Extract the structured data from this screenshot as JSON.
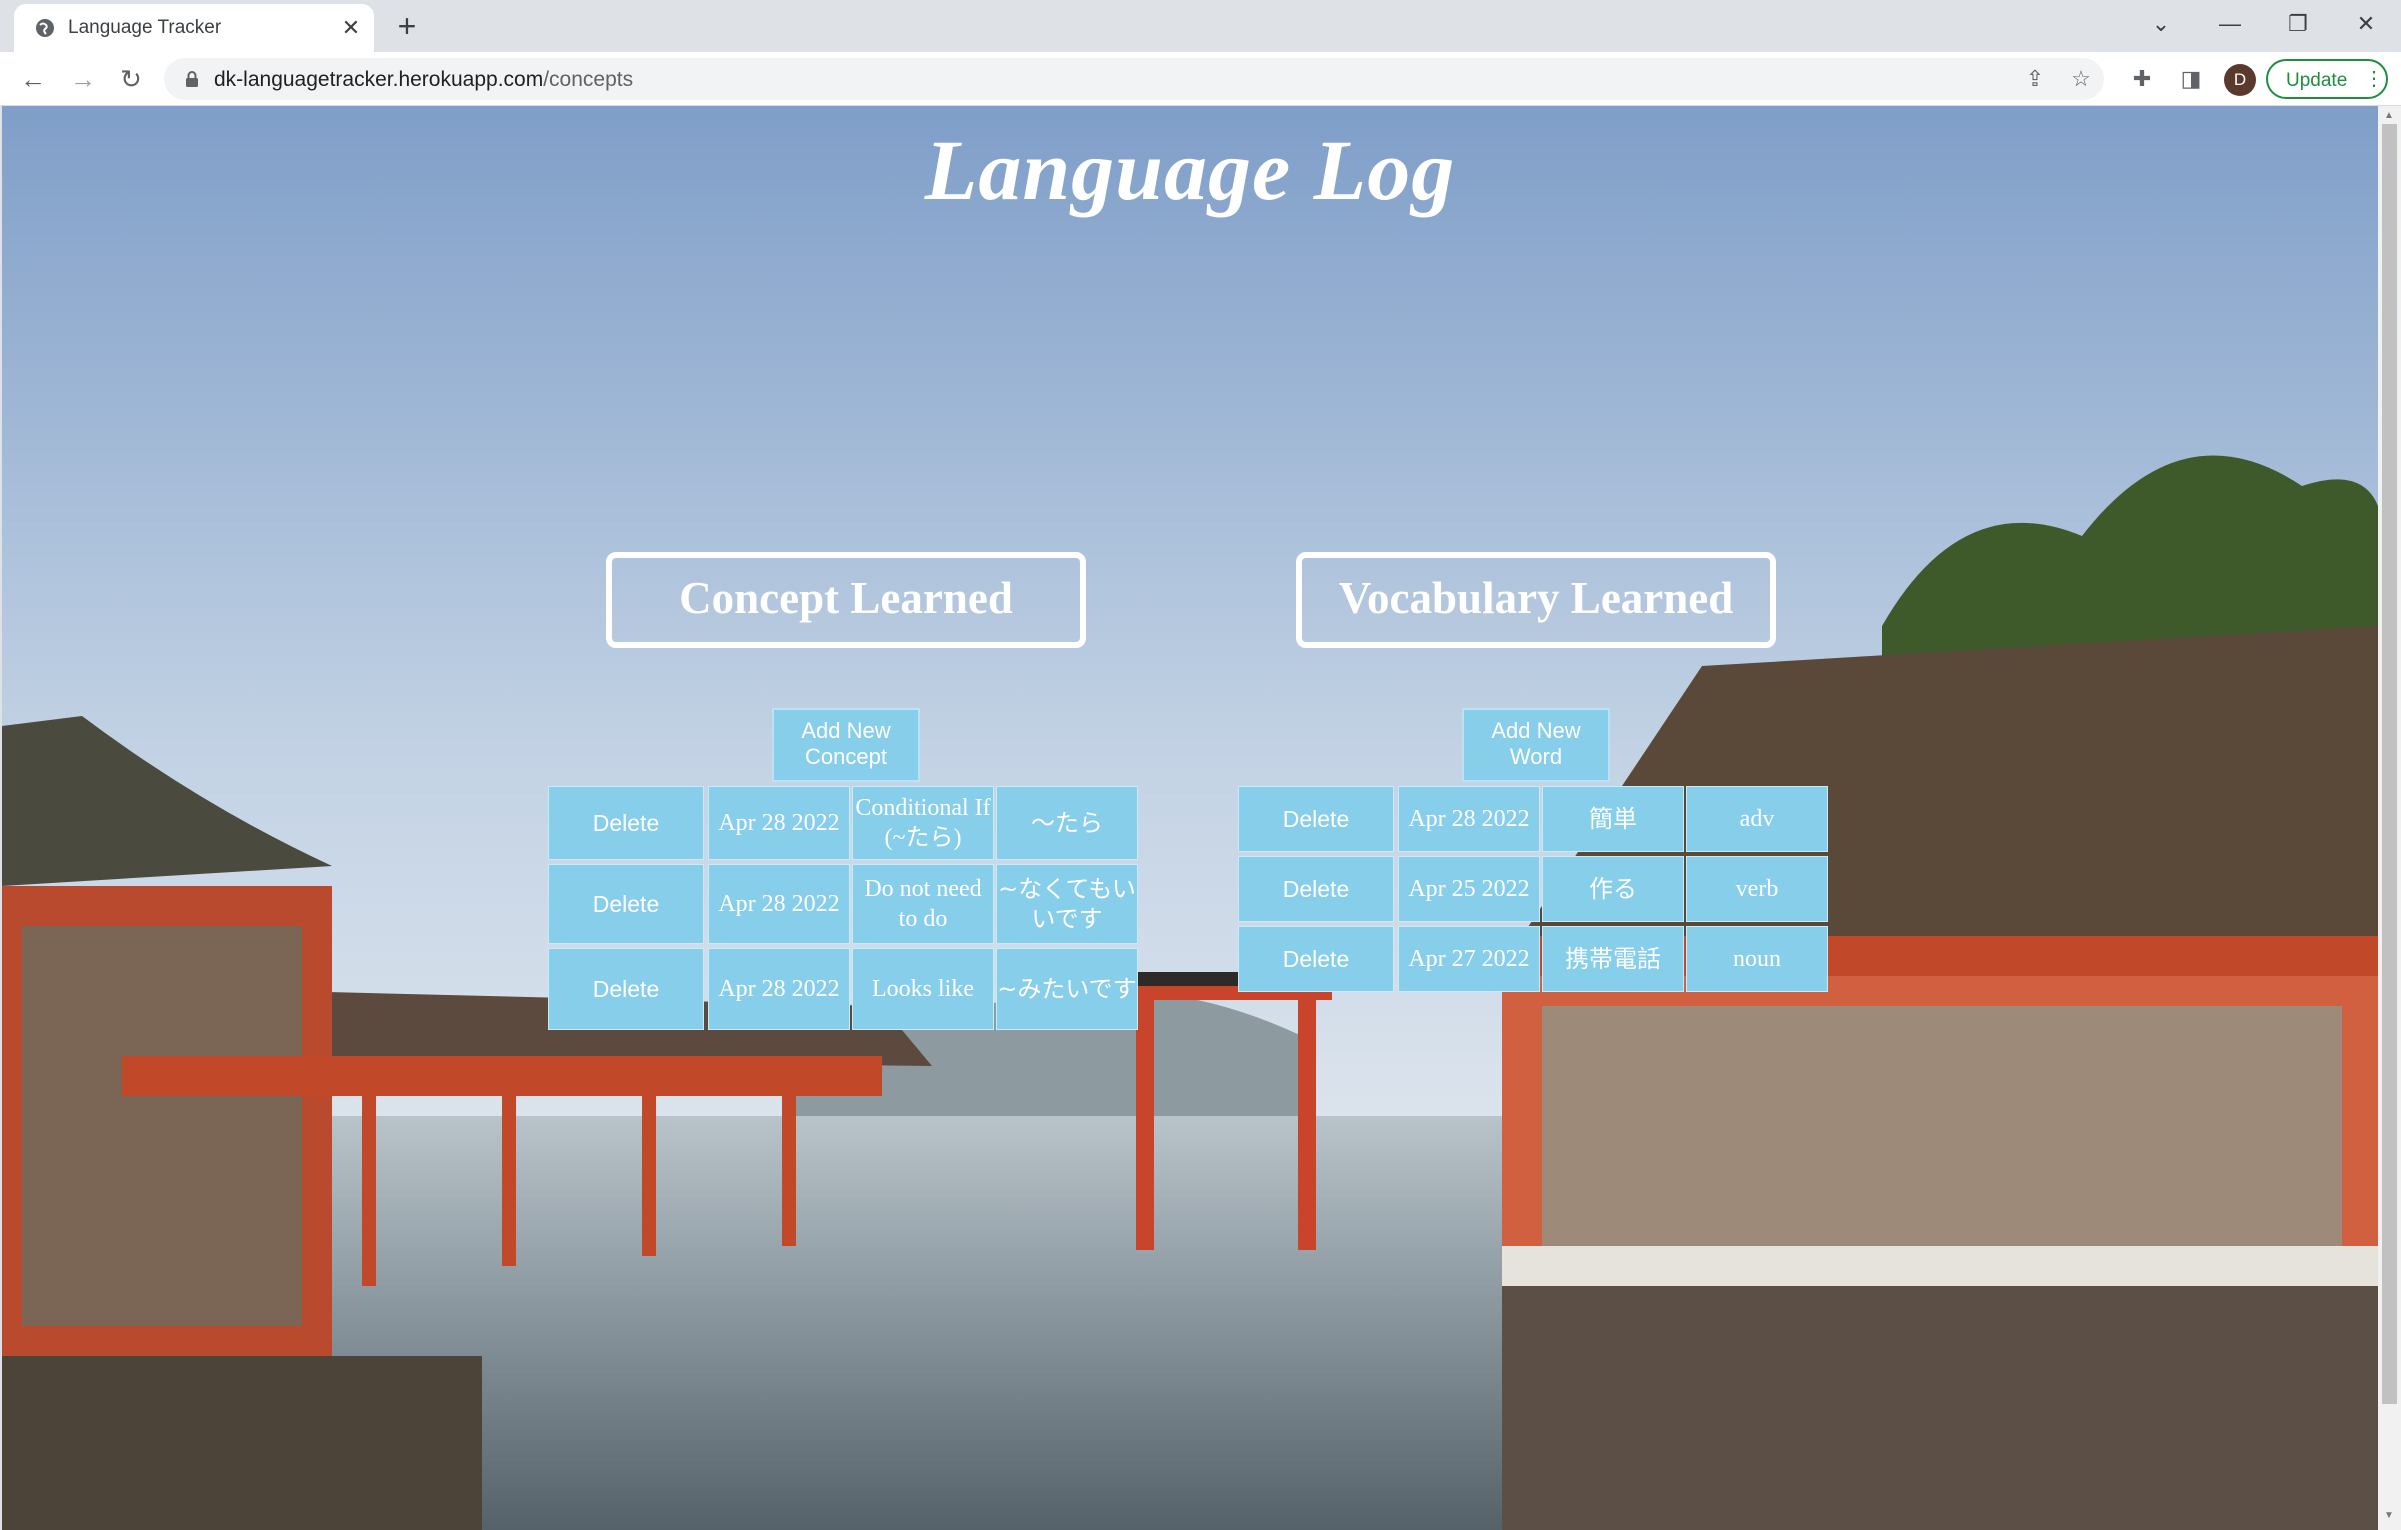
{
  "browser": {
    "tab_title": "Language Tracker",
    "tab_close": "✕",
    "new_tab": "+",
    "url_host": "dk-languagetracker.herokuapp.com",
    "url_path": "/concepts",
    "profile_initial": "D",
    "update_label": "Update",
    "icons": [
      "globe-icon",
      "back-icon",
      "forward-icon",
      "reload-icon",
      "lock-icon",
      "share-icon",
      "star-icon",
      "extensions-icon",
      "side-panel-icon",
      "menu-icon"
    ]
  },
  "page": {
    "title": "Language Log"
  },
  "concepts": {
    "heading": "Concept Learned",
    "add_button": "Add New Concept",
    "rows": [
      {
        "delete": "Delete",
        "date": "Apr 28 2022",
        "meaning": "Conditional If (~たら)",
        "grammar": "〜たら"
      },
      {
        "delete": "Delete",
        "date": "Apr 28 2022",
        "meaning": "Do not need to do",
        "grammar": "~なくてもいいです"
      },
      {
        "delete": "Delete",
        "date": "Apr 28 2022",
        "meaning": "Looks like",
        "grammar": "~みたいです"
      }
    ]
  },
  "vocabulary": {
    "heading": "Vocabulary Learned",
    "add_button": "Add New Word",
    "rows": [
      {
        "delete": "Delete",
        "date": "Apr 28 2022",
        "word": "簡単",
        "type": "adv"
      },
      {
        "delete": "Delete",
        "date": "Apr 25 2022",
        "word": "作る",
        "type": "verb"
      },
      {
        "delete": "Delete",
        "date": "Apr 27 2022",
        "word": "携帯電話",
        "type": "noun"
      }
    ]
  },
  "colors": {
    "cell_bg": "#87ceeb",
    "text": "#ffffff",
    "update_green": "#1e8e3e"
  }
}
